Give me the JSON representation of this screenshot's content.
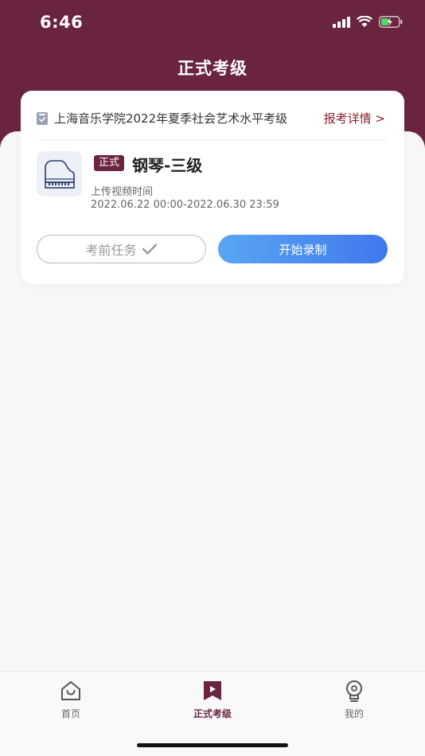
{
  "status": {
    "time": "6:46"
  },
  "header": {
    "title": "正式考级"
  },
  "card": {
    "exam_name": "上海音乐学院2022年夏季社会艺术水平考级",
    "detail_link": "报考详情 >",
    "badge": "正式",
    "subject": "钢琴-三级",
    "upload_label": "上传视频时间",
    "upload_time": "2022.06.22 00:00-2022.06.30 23:59",
    "task_button": "考前任务",
    "record_button": "开始录制"
  },
  "tabbar": {
    "items": [
      {
        "label": "首页",
        "icon": "home-icon"
      },
      {
        "label": "正式考级",
        "icon": "play-bookmark-icon",
        "active": true
      },
      {
        "label": "我的",
        "icon": "lightbulb-icon"
      }
    ]
  },
  "colors": {
    "brand": "#6b2440",
    "accent_start": "#5aa6f2",
    "accent_end": "#3f78ee",
    "link": "#8a1f2e"
  }
}
